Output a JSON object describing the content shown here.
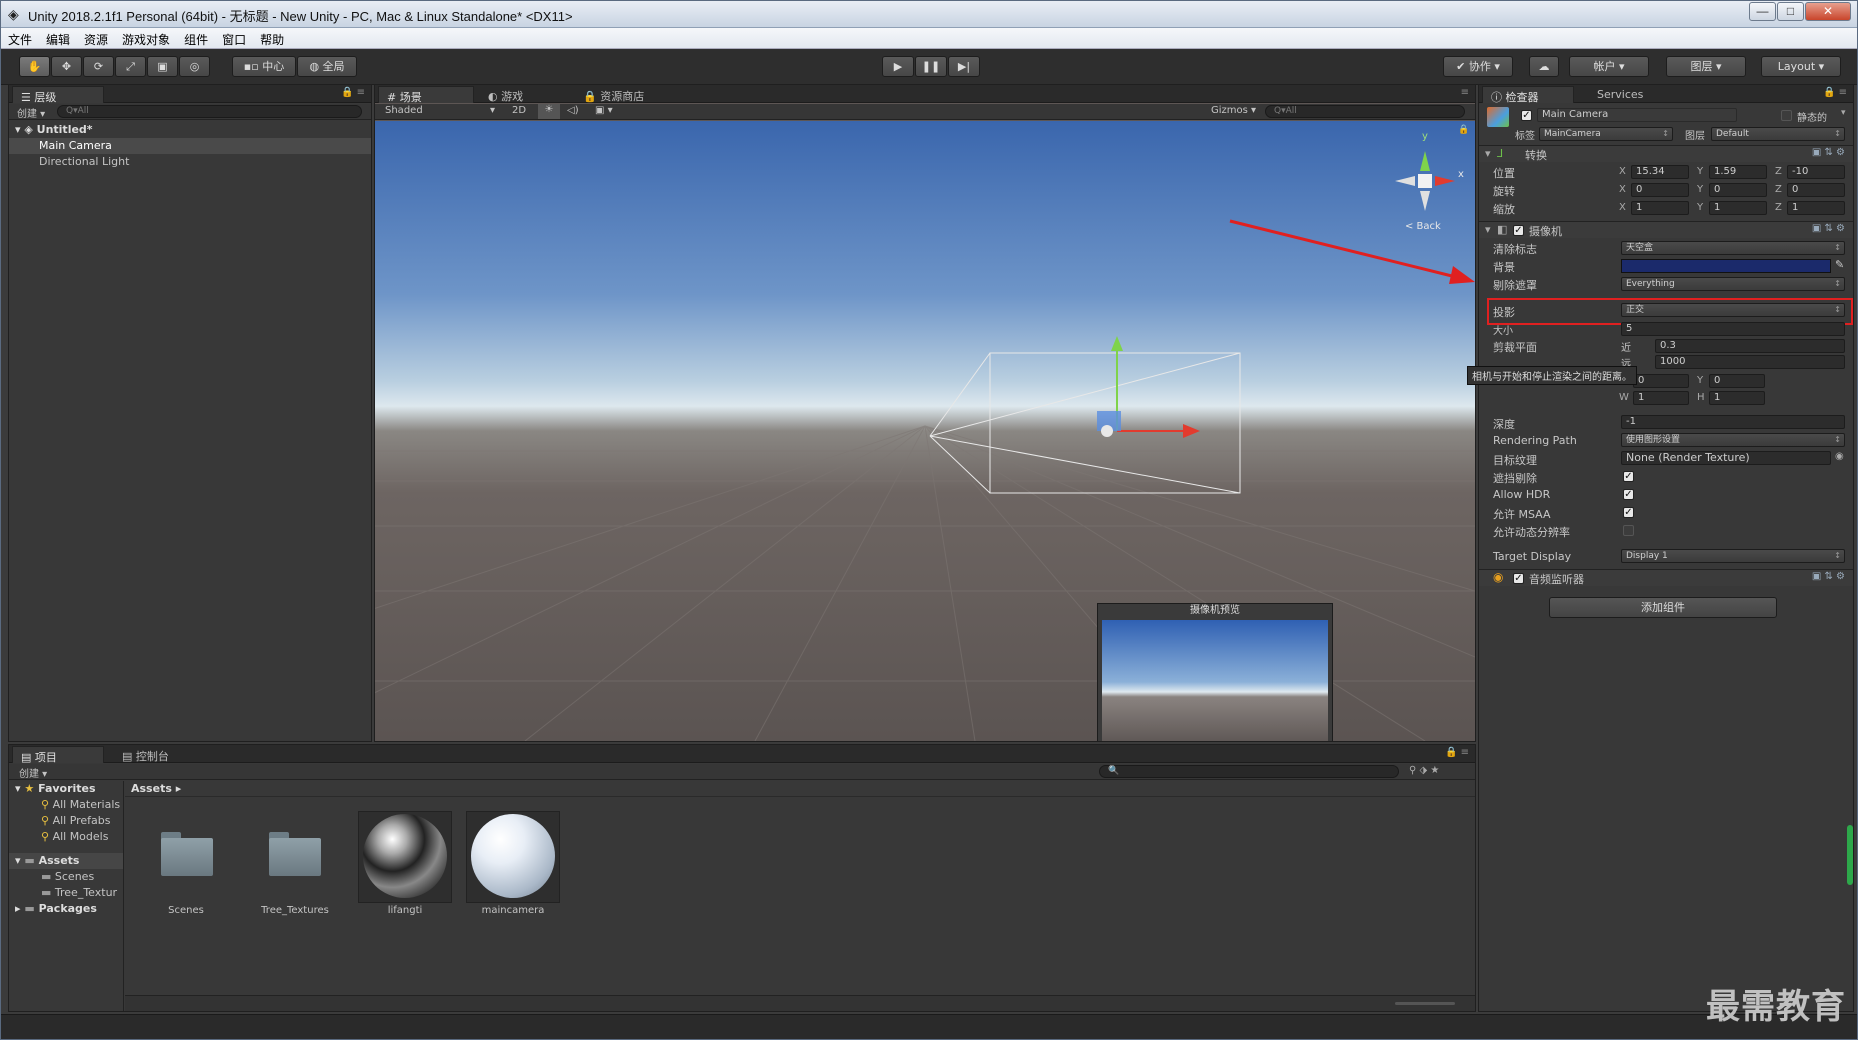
{
  "window": {
    "title": "Unity 2018.2.1f1 Personal (64bit) - 无标题 - New Unity - PC, Mac & Linux Standalone* <DX11>",
    "controls": [
      "—",
      "□",
      "✕"
    ]
  },
  "menu": [
    "文件",
    "编辑",
    "资源",
    "游戏对象",
    "组件",
    "窗口",
    "帮助"
  ],
  "toolbar": {
    "pivot_label": "中心",
    "global_label": "全局",
    "collab_label": "协作",
    "account_label": "帐户",
    "layers_label": "图层",
    "layout_label": "Layout"
  },
  "hierarchy": {
    "tab": "层级",
    "create": "创建",
    "search_placeholder": "Q▾All",
    "scene": "Untitled*",
    "items": [
      "Main Camera",
      "Directional Light"
    ]
  },
  "scene_view": {
    "tabs": [
      "场景",
      "游戏",
      "资源商店"
    ],
    "shading": "Shaded",
    "mode_2d": "2D",
    "gizmos": "Gizmos",
    "search_placeholder": "Q▾All",
    "gizmo_y": "y",
    "gizmo_x": "x",
    "back_label": "< Back",
    "preview_title": "摄像机预览"
  },
  "inspector": {
    "tabs": [
      "检查器",
      "Services"
    ],
    "object_name": "Main Camera",
    "static_label": "静态的",
    "tag_label": "标签",
    "tag_value": "MainCamera",
    "layer_label": "图层",
    "layer_value": "Default",
    "transform": {
      "title": "转换",
      "position_label": "位置",
      "rotation_label": "旋转",
      "scale_label": "缩放",
      "position": {
        "x": "15.34",
        "y": "1.59",
        "z": "-10"
      },
      "rotation": {
        "x": "0",
        "y": "0",
        "z": "0"
      },
      "scale": {
        "x": "1",
        "y": "1",
        "z": "1"
      }
    },
    "camera": {
      "title": "摄像机",
      "clear_flags_label": "清除标志",
      "clear_flags_value": "天空盒",
      "background_label": "背景",
      "culling_mask_label": "剔除遮罩",
      "culling_mask_value": "Everything",
      "projection_label": "投影",
      "projection_value": "正交",
      "size_label": "大小",
      "size_value": "5",
      "clipping_label": "剪裁平面",
      "near_label": "近",
      "near_value": "0.3",
      "far_label": "远",
      "far_value": "1000",
      "tooltip": "相机与开始和停止渲染之间的距离。",
      "viewport_x": "0",
      "viewport_y": "0",
      "viewport_w": "1",
      "viewport_h": "1",
      "depth_label": "深度",
      "depth_value": "-1",
      "rendering_path_label": "Rendering Path",
      "rendering_path_value": "使用图形设置",
      "target_texture_label": "目标纹理",
      "target_texture_value": "None (Render Texture)",
      "occlusion_label": "遮挡剔除",
      "hdr_label": "Allow HDR",
      "msaa_label": "允许 MSAA",
      "dynamic_res_label": "允许动态分辨率",
      "target_display_label": "Target Display",
      "target_display_value": "Display 1",
      "background_color": "#1b2a6b"
    },
    "audio_listener_title": "音频监听器",
    "add_component": "添加组件"
  },
  "project": {
    "tabs": [
      "项目",
      "控制台"
    ],
    "create": "创建",
    "favorites_label": "Favorites",
    "favorites": [
      "All Materials",
      "All Prefabs",
      "All Models"
    ],
    "assets_label": "Assets",
    "asset_folders": [
      "Scenes",
      "Tree_Textur"
    ],
    "packages_label": "Packages",
    "breadcrumb": "Assets ▸",
    "items": [
      "Scenes",
      "Tree_Textures",
      "lifangti",
      "maincamera"
    ]
  },
  "watermark": "最需教育",
  "colors": {
    "highlight_box": "#e02020",
    "arrow": "#e02020",
    "accent": "#3d6fb6"
  }
}
